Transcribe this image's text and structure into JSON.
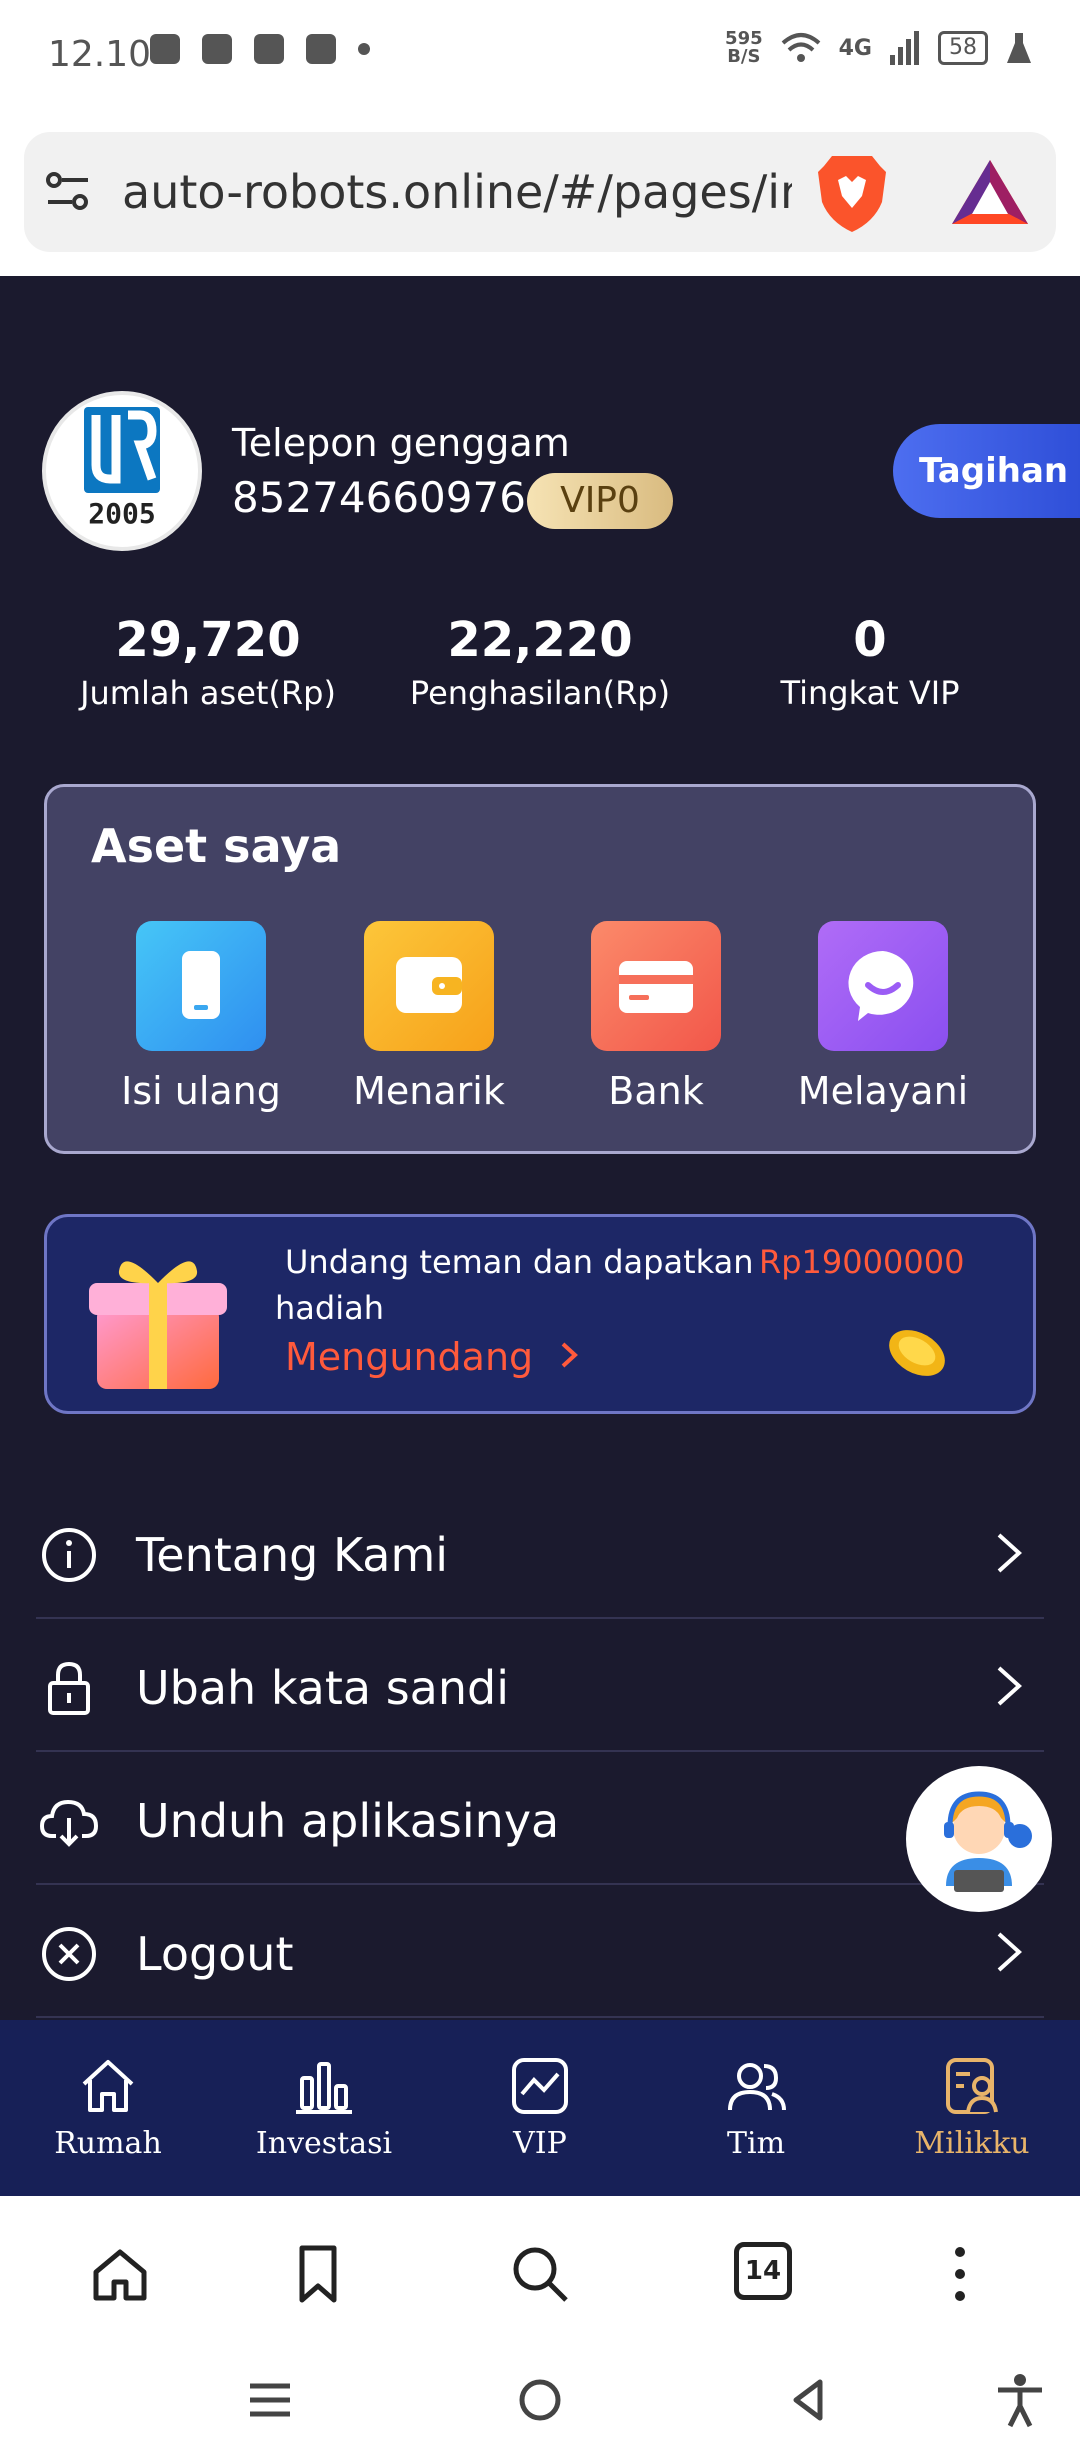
{
  "status_bar": {
    "time": "12.10",
    "net_speed_value": "595",
    "net_speed_unit": "B/S",
    "network": "4G",
    "battery": "58"
  },
  "browser": {
    "url": "auto-robots.online/#/pages/inc",
    "tab_count": "14"
  },
  "profile": {
    "logo_text": "2005",
    "label": "Telepon genggam",
    "phone": "85274660976",
    "vip_badge": "VIP0",
    "bill_button": "Tagihan"
  },
  "stats": [
    {
      "value": "29,720",
      "label": "Jumlah aset(Rp)"
    },
    {
      "value": "22,220",
      "label": "Penghasilan(Rp)"
    },
    {
      "value": "0",
      "label": "Tingkat VIP"
    }
  ],
  "assets": {
    "title": "Aset saya",
    "items": [
      {
        "label": "Isi ulang",
        "icon": "phone-icon",
        "color": "#3aa7f0"
      },
      {
        "label": "Menarik",
        "icon": "wallet-icon",
        "color": "#f7b421"
      },
      {
        "label": "Bank",
        "icon": "card-icon",
        "color": "#f66f5a"
      },
      {
        "label": "Melayani",
        "icon": "chat-icon",
        "color": "#9b5cf5"
      }
    ]
  },
  "invite": {
    "text": "Undang teman dan dapatkan",
    "amount": "Rp19000000",
    "text2": "hadiah",
    "link": "Mengundang"
  },
  "menu": [
    {
      "label": "Tentang Kami",
      "icon": "info-icon"
    },
    {
      "label": "Ubah kata sandi",
      "icon": "lock-icon"
    },
    {
      "label": "Unduh aplikasinya",
      "icon": "cloud-download-icon"
    },
    {
      "label": "Logout",
      "icon": "close-circle-icon"
    }
  ],
  "tabs": [
    {
      "label": "Rumah",
      "icon": "home-icon"
    },
    {
      "label": "Investasi",
      "icon": "bar-chart-icon"
    },
    {
      "label": "VIP",
      "icon": "trend-icon"
    },
    {
      "label": "Tim",
      "icon": "users-icon"
    },
    {
      "label": "Milikku",
      "icon": "profile-icon",
      "active": true
    }
  ],
  "colors": {
    "page_bg": "#1b1a2e",
    "tab_active": "#e8b46a",
    "accent_orange": "#ff5a3c",
    "tabbar_bg": "#172057"
  }
}
